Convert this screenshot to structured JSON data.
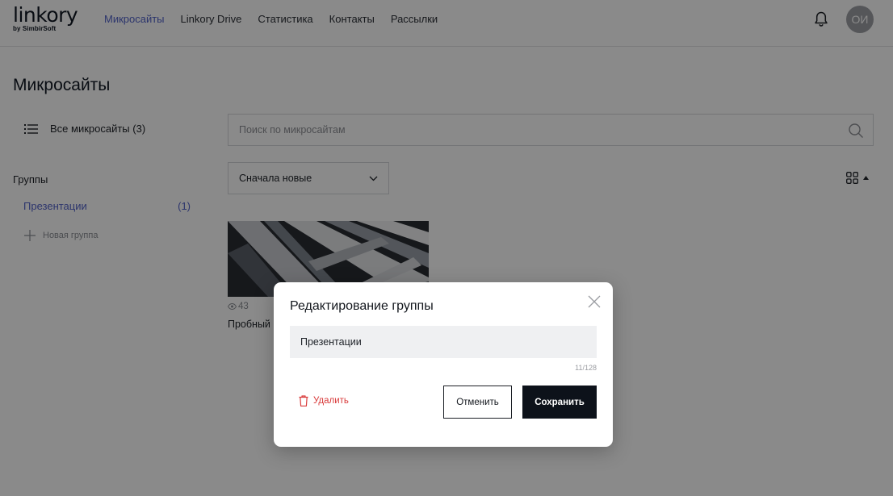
{
  "header": {
    "logo": "linkory",
    "logo_sub": "by SimbirSoft",
    "nav": [
      {
        "label": "Микросайты",
        "active": true
      },
      {
        "label": "Linkory Drive",
        "active": false
      },
      {
        "label": "Статистика",
        "active": false
      },
      {
        "label": "Контакты",
        "active": false
      },
      {
        "label": "Рассылки",
        "active": false
      }
    ],
    "bell_icon": "bell-icon",
    "avatar_initials": "ОИ"
  },
  "page": {
    "title": "Микросайты"
  },
  "sidebar": {
    "all_sites_label": "Все микросайты (3)",
    "all_sites_icon": "list-icon",
    "groups_title": "Группы",
    "groups": [
      {
        "label": "Презентации",
        "count": "(1)"
      }
    ],
    "new_group_label": "Новая группа",
    "new_group_icon": "plus-icon"
  },
  "search": {
    "placeholder": "Поиск по микросайтам",
    "value": "",
    "icon": "search-icon"
  },
  "sort": {
    "selected": "Сначала новые",
    "icon": "chevron-down-icon"
  },
  "view_toggle": {
    "icon": "grid-view-icon",
    "caret": "caret-up-icon"
  },
  "cards": [
    {
      "views": "43",
      "title": "Пробный",
      "views_icon": "eye-icon"
    }
  ],
  "modal": {
    "title": "Редактирование группы",
    "input_value": "Презентации",
    "counter": "11/128",
    "delete_label": "Удалить",
    "cancel_label": "Отменить",
    "save_label": "Сохранить",
    "close_icon": "close-icon",
    "delete_icon": "trash-icon"
  },
  "colors": {
    "accent": "#5263c9",
    "danger": "#d93b3b",
    "primary_button": "#0d121a",
    "overlay": "rgba(0,0,0,0.46)"
  }
}
